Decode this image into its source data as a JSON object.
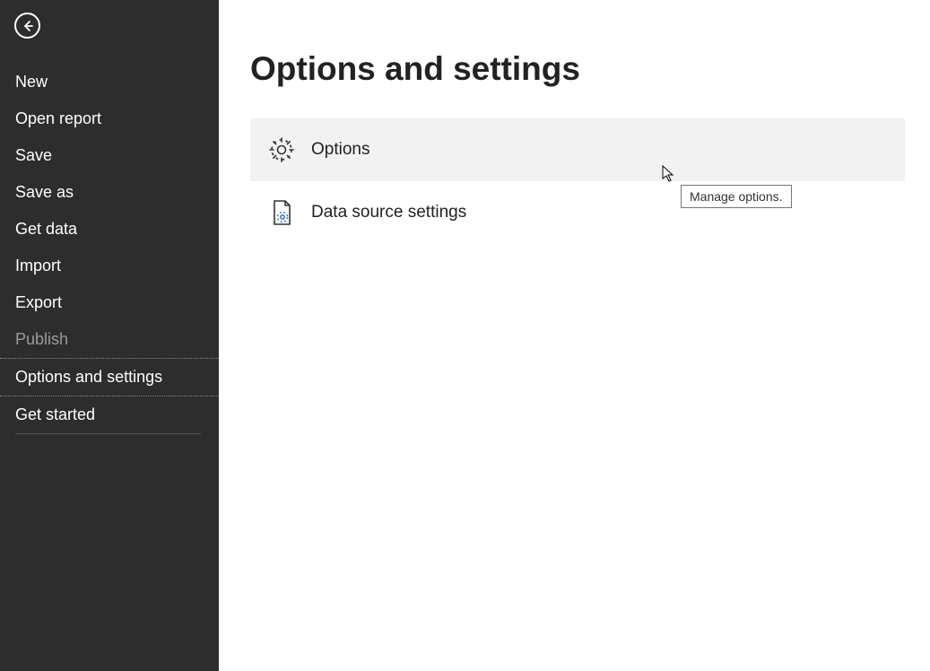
{
  "sidebar": {
    "items": [
      {
        "label": "New",
        "state": "normal"
      },
      {
        "label": "Open report",
        "state": "normal"
      },
      {
        "label": "Save",
        "state": "normal"
      },
      {
        "label": "Save as",
        "state": "normal"
      },
      {
        "label": "Get data",
        "state": "normal"
      },
      {
        "label": "Import",
        "state": "normal"
      },
      {
        "label": "Export",
        "state": "normal"
      },
      {
        "label": "Publish",
        "state": "disabled"
      },
      {
        "label": "Options and settings",
        "state": "selected"
      },
      {
        "label": "Get started",
        "state": "underlined"
      }
    ]
  },
  "main": {
    "title": "Options and settings",
    "items": [
      {
        "label": "Options",
        "icon": "gear",
        "hovered": true
      },
      {
        "label": "Data source settings",
        "icon": "doc-gear",
        "hovered": false
      }
    ]
  },
  "tooltip": {
    "text": "Manage options."
  }
}
